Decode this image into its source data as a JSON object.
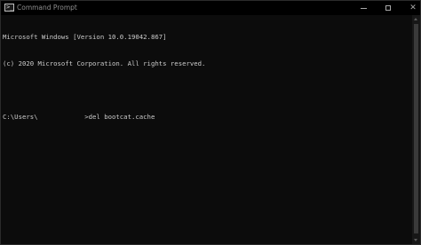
{
  "window": {
    "title": "Command Prompt",
    "icon": "cmd-icon",
    "controls": {
      "minimize": "minimize-icon",
      "maximize": "maximize-icon",
      "close": "close-icon"
    }
  },
  "console": {
    "lines": [
      "Microsoft Windows [Version 10.0.19042.867]",
      "(c) 2020 Microsoft Corporation. All rights reserved.",
      "",
      "C:\\Users\\            >del bootcat.cache"
    ]
  },
  "colors": {
    "background": "#0c0c0c",
    "text": "#cccccc",
    "titlebar": "#000000"
  }
}
